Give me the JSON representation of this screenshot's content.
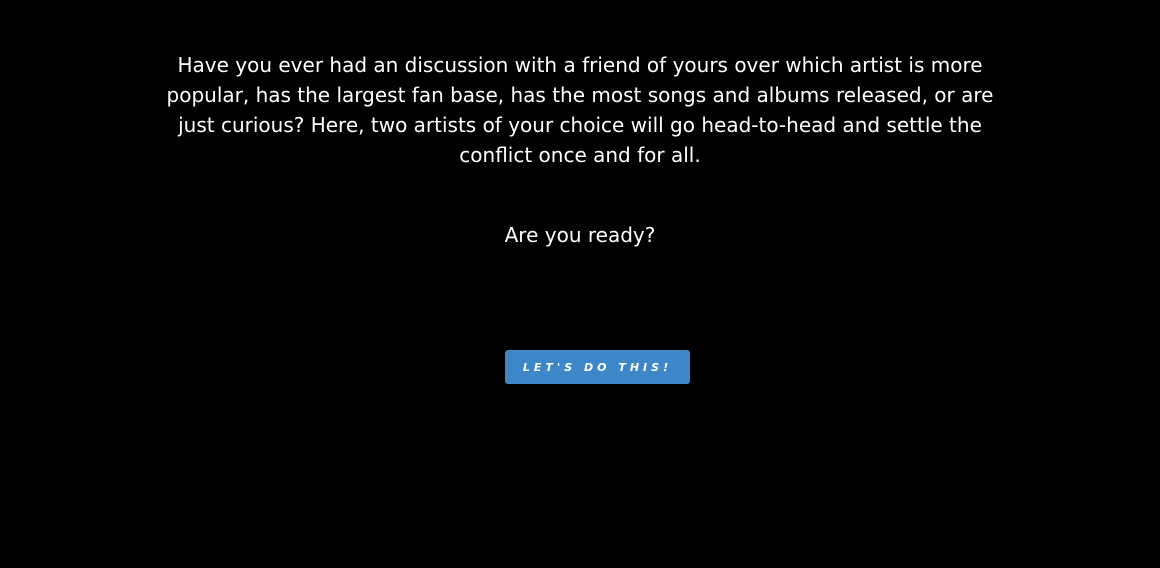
{
  "intro": {
    "text": "Have you ever had an discussion with a friend of yours over which artist is more popular, has the largest fan base, has the most songs and albums released, or are just curious? Here, two artists of your choice will go head-to-head and settle the conflict once and for all."
  },
  "prompt": {
    "text": "Are you ready?"
  },
  "cta": {
    "label": "Let's do this!"
  },
  "colors": {
    "background": "#000000",
    "text": "#ffffff",
    "button": "#3d86c8"
  }
}
